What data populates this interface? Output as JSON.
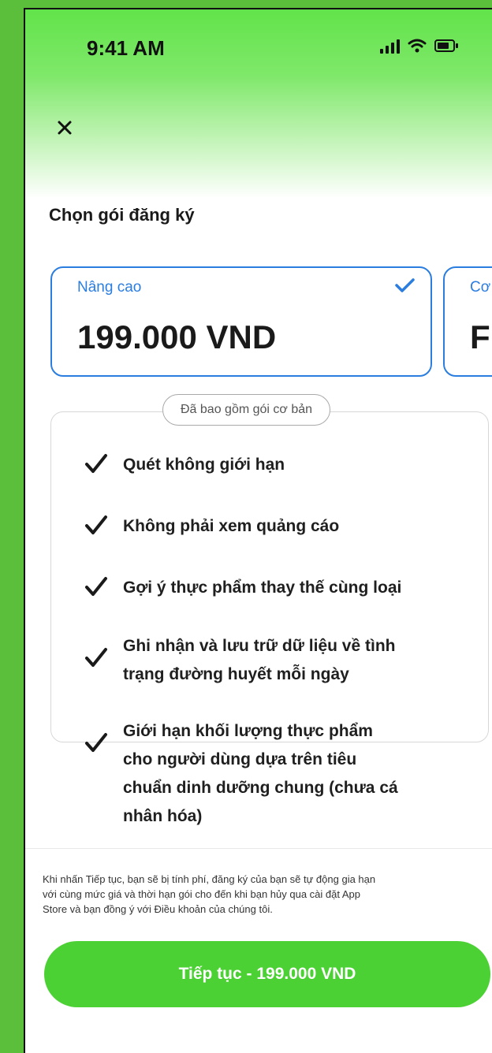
{
  "status_bar": {
    "time": "9:41 AM"
  },
  "header": {
    "close_icon": "close-icon"
  },
  "section": {
    "title": "Chọn gói đăng ký"
  },
  "plans": [
    {
      "name": "Nâng cao",
      "price": "199.000 VND",
      "selected": true
    },
    {
      "name": "Cơ bản",
      "price": "Fr"
    }
  ],
  "features": {
    "badge": "Đã bao gồm gói cơ bản",
    "items": [
      {
        "lines": [
          "Quét không giới hạn"
        ]
      },
      {
        "lines": [
          "Không phải xem quảng cáo"
        ]
      },
      {
        "lines": [
          "Gợi ý thực phẩm thay thế cùng loại"
        ]
      },
      {
        "lines": [
          "Ghi nhận và lưu trữ dữ liệu về tình",
          "trạng đường huyết mỗi ngày"
        ]
      },
      {
        "lines": [
          "Giới hạn khối lượng thực phẩm",
          "cho người dùng dựa trên tiêu",
          "chuẩn dinh dưỡng chung (chưa cá",
          "nhân hóa)"
        ]
      }
    ]
  },
  "footer": {
    "disclaimer": [
      "Khi nhấn Tiếp tục, bạn sẽ bị tính phí, đăng ký của bạn sẽ tự động gia hạn",
      "với cùng mức giá và thời hạn gói cho đến khi bạn hủy qua cài đặt App",
      "Store và bạn đồng ý với Điều khoản của chúng tôi."
    ],
    "cta_label": "Tiếp tục - 199.000 VND"
  },
  "colors": {
    "accent_blue": "#2b7de0",
    "cta_green": "#4cd134",
    "background_green": "#5cbf3c"
  }
}
